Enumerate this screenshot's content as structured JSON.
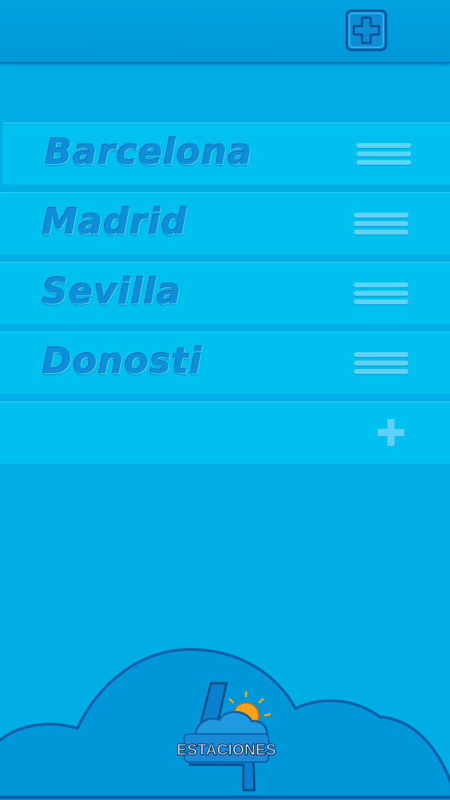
{
  "header": {
    "add_button_icon": "plus-square-icon"
  },
  "cities": [
    {
      "name": "Barcelona"
    },
    {
      "name": "Madrid"
    },
    {
      "name": "Sevilla"
    },
    {
      "name": "Donosti"
    }
  ],
  "add_row": {
    "icon": "plus-icon"
  },
  "logo": {
    "text": "ESTACIONES",
    "numeral": "4"
  },
  "colors": {
    "background": "#00aee6",
    "header": "#00a0de",
    "row": "#00c0ef",
    "city_text": "#0a8fd8",
    "logo_cloud": "#0097d9"
  }
}
